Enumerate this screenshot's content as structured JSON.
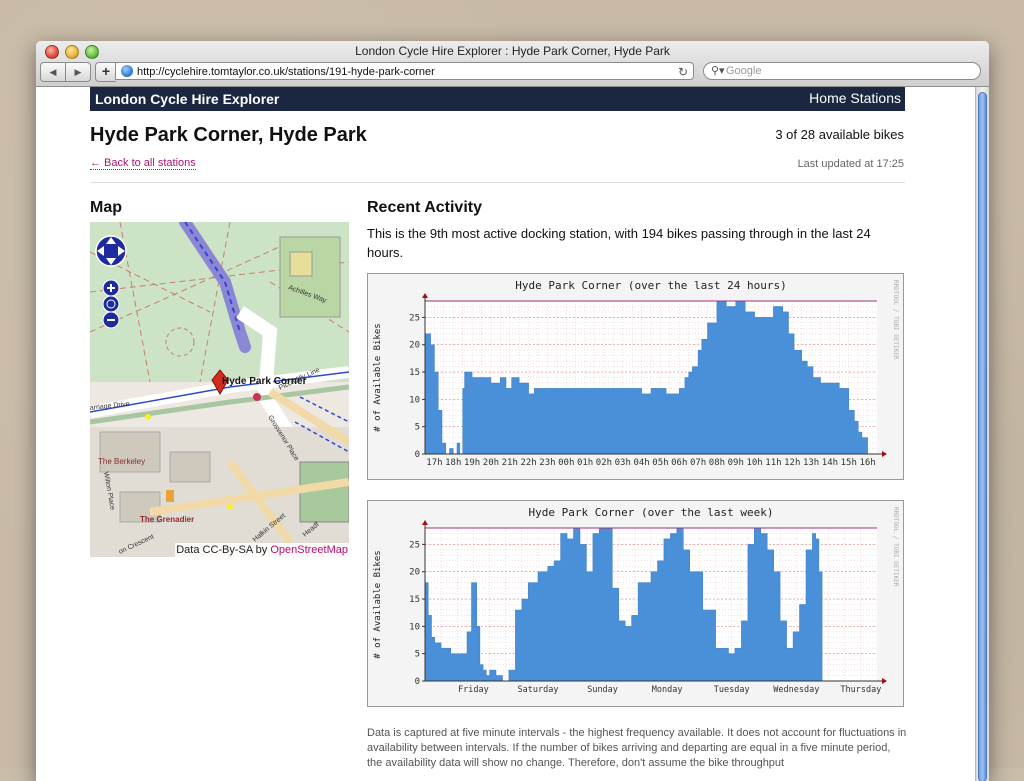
{
  "window": {
    "title": "London Cycle Hire Explorer : Hyde Park Corner, Hyde Park",
    "url": "http://cyclehire.tomtaylor.co.uk/stations/191-hyde-park-corner",
    "search_placeholder": "Google"
  },
  "site": {
    "title": "London Cycle Hire Explorer",
    "home_link": "Home Stations"
  },
  "station": {
    "name": "Hyde Park Corner, Hyde Park",
    "back_link": "← Back to all stations",
    "availability": "3 of 28 available bikes",
    "last_updated": "Last updated at 17:25"
  },
  "map": {
    "heading": "Map",
    "attribution_prefix": "Data CC-By-SA by ",
    "attribution_link": "OpenStreetMap",
    "labels": {
      "marker": "Hyde Park Corner",
      "achilles": "Achilles Way",
      "piccadilly": "Piccadilly Line",
      "carriage": "arriage Drive",
      "grosvenor": "Grosvenor Place",
      "berkeley": "The Berkeley",
      "wilton": "Wilton Place",
      "grenadier": "The Grenadier",
      "crescent": "on Crescent",
      "halkin": "Halkin Street",
      "headf": "Headf"
    }
  },
  "activity": {
    "heading": "Recent Activity",
    "description": "This is the 9th most active docking station, with 194 bikes passing through in the last 24 hours.",
    "footnote": "Data is captured at five minute intervals - the highest frequency available. It does not account for fluctuations in availability between intervals. If the number of bikes arriving and departing are equal in a five minute period, the availability data will show no change. Therefore, don't assume the bike throughput"
  },
  "chart_data": [
    {
      "type": "area",
      "title": "Hyde Park Corner (over the last 24 hours)",
      "ylabel": "# of Available Bikes",
      "watermark": "RRDTOOL / TOBI OETIKER",
      "ylim": [
        0,
        28
      ],
      "yticks": [
        0,
        5,
        10,
        15,
        20,
        25
      ],
      "capacity": 28,
      "categories": [
        "17h",
        "18h",
        "19h",
        "20h",
        "21h",
        "22h",
        "23h",
        "00h",
        "01h",
        "02h",
        "03h",
        "04h",
        "05h",
        "06h",
        "07h",
        "08h",
        "09h",
        "10h",
        "11h",
        "12h",
        "13h",
        "14h",
        "15h",
        "16h"
      ],
      "x": [
        0,
        0.3,
        0.5,
        0.7,
        0.9,
        1.1,
        1.3,
        1.5,
        1.7,
        1.85,
        2.0,
        2.1,
        2.3,
        2.5,
        2.75,
        3.0,
        3.5,
        4.0,
        4.3,
        4.6,
        5.0,
        5.5,
        5.8,
        6.2,
        7.0,
        8.0,
        9.0,
        10.0,
        11.0,
        11.5,
        12.0,
        12.5,
        12.8,
        13.2,
        13.5,
        13.8,
        14.0,
        14.2,
        14.5,
        14.7,
        15.0,
        15.5,
        16.0,
        16.5,
        17.0,
        17.5,
        18.0,
        18.5,
        19.0,
        19.3,
        19.6,
        20.0,
        20.3,
        20.6,
        21.0,
        21.5,
        22.0,
        22.5,
        22.8,
        23.0,
        23.2,
        23.5
      ],
      "values": [
        22,
        20,
        15,
        8,
        2,
        0,
        1,
        0,
        2,
        0,
        12,
        15,
        15,
        14,
        14,
        14,
        13,
        14,
        12,
        14,
        13,
        11,
        12,
        12,
        12,
        12,
        12,
        12,
        12,
        11,
        12,
        12,
        11,
        11,
        12,
        14,
        15,
        16,
        19,
        21,
        24,
        28,
        27,
        28,
        26,
        25,
        25,
        27,
        26,
        22,
        19,
        17,
        16,
        14,
        13,
        13,
        12,
        8,
        6,
        4,
        3,
        2
      ]
    },
    {
      "type": "area",
      "title": "Hyde Park Corner (over the last week)",
      "ylabel": "# of Available Bikes",
      "watermark": "RRDTOOL / TOBI OETIKER",
      "ylim": [
        0,
        28
      ],
      "yticks": [
        0,
        5,
        10,
        15,
        20,
        25
      ],
      "capacity": 28,
      "categories": [
        "Friday",
        "Saturday",
        "Sunday",
        "Monday",
        "Tuesday",
        "Wednesday",
        "Thursday"
      ],
      "x": [
        0,
        0.05,
        0.1,
        0.15,
        0.25,
        0.4,
        0.55,
        0.65,
        0.72,
        0.8,
        0.85,
        0.9,
        0.95,
        1.0,
        1.1,
        1.2,
        1.3,
        1.4,
        1.5,
        1.6,
        1.75,
        1.9,
        2.0,
        2.1,
        2.2,
        2.3,
        2.4,
        2.5,
        2.6,
        2.7,
        2.8,
        2.9,
        3.0,
        3.1,
        3.2,
        3.3,
        3.5,
        3.6,
        3.7,
        3.8,
        3.9,
        4.0,
        4.1,
        4.3,
        4.5,
        4.7,
        4.8,
        4.9,
        5.0,
        5.1,
        5.2,
        5.3,
        5.4,
        5.5,
        5.6,
        5.7,
        5.8,
        5.9,
        6.0,
        6.05,
        6.1,
        6.15
      ],
      "values": [
        18,
        12,
        8,
        7,
        6,
        5,
        5,
        9,
        18,
        10,
        3,
        2,
        1,
        2,
        1,
        0,
        2,
        13,
        15,
        18,
        20,
        21,
        22,
        27,
        26,
        28,
        25,
        20,
        27,
        28,
        28,
        17,
        11,
        10,
        12,
        18,
        20,
        22,
        26,
        27,
        28,
        24,
        20,
        13,
        6,
        5,
        6,
        11,
        25,
        28,
        27,
        24,
        20,
        11,
        6,
        9,
        14,
        24,
        27,
        26,
        20,
        1
      ]
    }
  ]
}
